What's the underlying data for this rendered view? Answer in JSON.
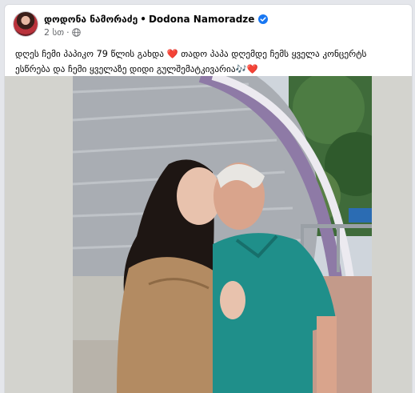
{
  "post": {
    "author": "დოდონა ნამორაძე",
    "separator": "•",
    "author_latin": "Dodona Namoradze",
    "time": "2 სთ",
    "meta_separator": "·",
    "text": "დღეს ჩემი პაპიკო 79 წლის გახდა ❤️ თადო პაპა დღემდე ჩემს ყველა კონცერტს ესწრება და ჩემი ყველაზე დიდი გულშემატკივარია🎶❤️"
  },
  "icons": {
    "verified": "verified-badge-icon",
    "audience": "globe-icon"
  },
  "colors": {
    "verified": "#1877f2",
    "meta_text": "#65676b",
    "feed_bg": "#e4e6eb"
  }
}
